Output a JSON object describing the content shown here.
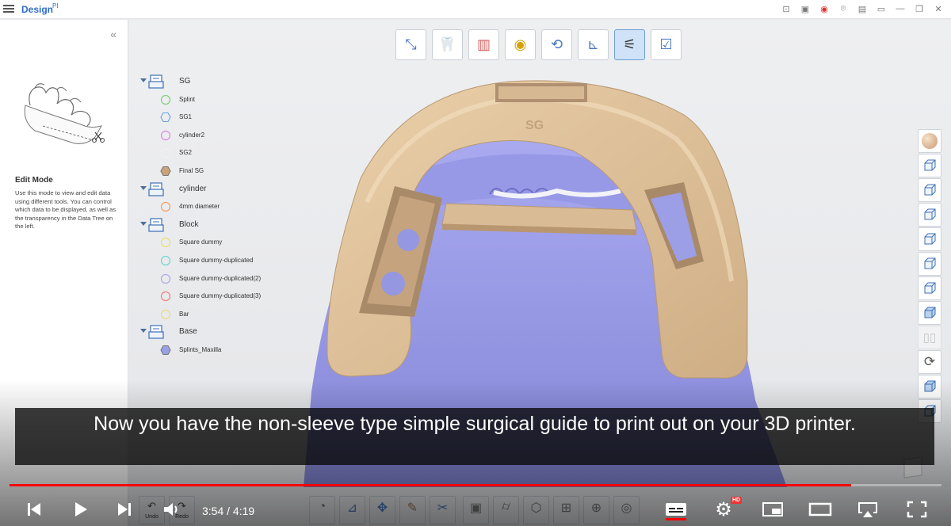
{
  "app": {
    "title": "Design",
    "title_suffix": "PI"
  },
  "help": {
    "collapse_icon": "double-chevron-left-icon",
    "title": "Edit Mode",
    "description": "Use this mode to view and edit data using different tools. You can control which data to be displayed, as well as the transparency in the Data Tree on the left."
  },
  "toolstrip": [
    {
      "icon": "align-icon",
      "active": false
    },
    {
      "icon": "tooth-icon",
      "active": false
    },
    {
      "icon": "deviation-map-icon",
      "active": false
    },
    {
      "icon": "thickness-map-icon",
      "active": false
    },
    {
      "icon": "axis-rotate-icon",
      "active": false
    },
    {
      "icon": "measure-icon",
      "active": false
    },
    {
      "icon": "sliders-tools-icon",
      "active": true
    },
    {
      "icon": "clipboard-check-icon",
      "active": false
    }
  ],
  "tree": [
    {
      "label": "SG",
      "children": [
        {
          "label": "Splint",
          "shape": "circle",
          "color": "#7fcf7a"
        },
        {
          "label": "SG1",
          "shape": "hexagon",
          "color": "#6aa0e0"
        },
        {
          "label": "cylinder2",
          "shape": "circle",
          "color": "#d98be0"
        },
        {
          "label": "SG2",
          "shape": "circle",
          "color": "#f0f0f0"
        },
        {
          "label": "Final SG",
          "shape": "hexagon-filled",
          "color": "#caa37a"
        }
      ]
    },
    {
      "label": "cylinder",
      "children": [
        {
          "label": "4mm diameter",
          "shape": "circle",
          "color": "#f0a060"
        }
      ]
    },
    {
      "label": "Block",
      "children": [
        {
          "label": "Square dummy",
          "shape": "circle",
          "color": "#e8e070"
        },
        {
          "label": "Square dummy-duplicated",
          "shape": "circle",
          "color": "#6dd6d0"
        },
        {
          "label": "Square dummy-duplicated(2)",
          "shape": "circle",
          "color": "#b6a6e8"
        },
        {
          "label": "Square dummy-duplicated(3)",
          "shape": "circle",
          "color": "#f08080"
        },
        {
          "label": "Bar",
          "shape": "circle",
          "color": "#e6e080"
        }
      ]
    },
    {
      "label": "Base",
      "children": [
        {
          "label": "Splints_Maxilla",
          "shape": "hexagon-filled",
          "color": "#9aa0e8"
        }
      ]
    }
  ],
  "right_tools": [
    {
      "icon": "material-sphere-icon",
      "disabled": false
    },
    {
      "icon": "cube-front-view-icon",
      "disabled": false
    },
    {
      "icon": "cube-back-view-icon",
      "disabled": false
    },
    {
      "icon": "cube-left-view-icon",
      "disabled": false
    },
    {
      "icon": "cube-right-view-icon",
      "disabled": false
    },
    {
      "icon": "cube-top-view-icon",
      "disabled": false
    },
    {
      "icon": "cube-bottom-view-icon",
      "disabled": false
    },
    {
      "icon": "cube-iso-view-icon",
      "disabled": false
    },
    {
      "icon": "split-view-icon",
      "disabled": true
    },
    {
      "icon": "rotate-view-icon",
      "disabled": false
    },
    {
      "icon": "cube-shade-icon",
      "disabled": false
    },
    {
      "icon": "clip-view-icon",
      "disabled": false
    }
  ],
  "app_toolbar": {
    "undo_label": "Undo",
    "redo_label": "Redo"
  },
  "model_emboss": "SG",
  "player": {
    "caption": "Now you have the non-sleeve type simple surgical guide to print out on your 3D printer.",
    "time_current": "3:54",
    "time_separator": " / ",
    "time_total": "4:19",
    "progress": 0.903,
    "hd_badge": "HD",
    "accent_color": "#ff0000"
  }
}
